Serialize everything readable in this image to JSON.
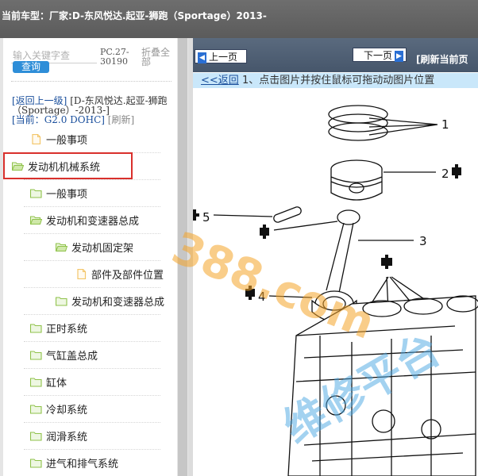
{
  "header": {
    "vehicle_label": "当前车型：",
    "vehicle_value": "厂家:D-东风悦达.起亚-狮跑（Sportage）2013-"
  },
  "sidebar": {
    "search_placeholder": "输入关键字查",
    "query_label": "查询",
    "pc_code": "PC.27-30190",
    "collapse_label": "折叠全部",
    "back_link": "[返回上一级]",
    "path_text": "[D-东风悦达.起亚-狮跑（Sportage）-2013-]",
    "current_label": "[当前：",
    "current_value": "G2.0 DOHC]",
    "refresh_label": "[刷新]",
    "items": [
      {
        "label": "一般事项",
        "icon": "document-icon"
      },
      {
        "label": "发动机机械系统",
        "icon": "folder-open-icon",
        "selected": true
      },
      {
        "label": "一般事项",
        "icon": "folder-icon"
      },
      {
        "label": "发动机和变速器总成",
        "icon": "folder-open-icon"
      },
      {
        "label": "发动机固定架",
        "icon": "folder-open-icon"
      },
      {
        "label": "部件及部件位置",
        "icon": "document-icon"
      },
      {
        "label": "发动机和变速器总成",
        "icon": "folder-icon"
      },
      {
        "label": "正时系统",
        "icon": "folder-icon"
      },
      {
        "label": "气缸盖总成",
        "icon": "folder-icon"
      },
      {
        "label": "缸体",
        "icon": "folder-icon"
      },
      {
        "label": "冷却系统",
        "icon": "folder-icon"
      },
      {
        "label": "润滑系统",
        "icon": "folder-icon"
      },
      {
        "label": "进气和排气系统",
        "icon": "folder-icon"
      }
    ]
  },
  "viewer": {
    "prev_label": "上一页",
    "next_label": "下一页",
    "refresh_label": "[刷新当前页",
    "back_link": "<<返回",
    "hint_text": "1、点击图片并按住鼠标可拖动动图片位置",
    "callouts": [
      "1",
      "2",
      "3",
      "4",
      "5"
    ],
    "watermark_number": "388.com",
    "watermark_text": "维修平台"
  },
  "colors": {
    "accent": "#2e8ed8",
    "selection_border": "#d9302c",
    "hint_background": "#c9e7fa",
    "folder_green": "#8fc24a",
    "document_yellow": "#f3c66a",
    "watermark_orange": "#f5a52a",
    "watermark_blue": "#4aa7e3"
  }
}
